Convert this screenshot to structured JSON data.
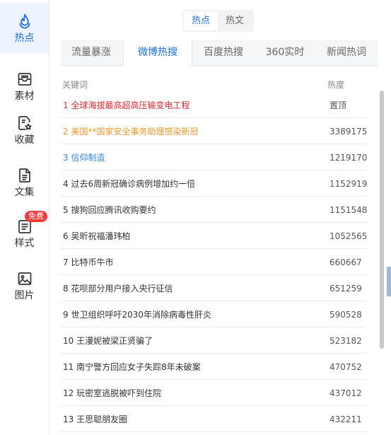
{
  "sidebar": {
    "items": [
      {
        "label": "热点",
        "icon": "flame-icon",
        "active": true
      },
      {
        "label": "素材",
        "icon": "inbox-icon"
      },
      {
        "label": "收藏",
        "icon": "bookmark-star-icon"
      },
      {
        "label": "文集",
        "icon": "document-icon"
      },
      {
        "label": "样式",
        "icon": "style-list-icon",
        "badge": "免费"
      },
      {
        "label": "图片",
        "icon": "image-icon"
      }
    ]
  },
  "segment": {
    "options": [
      "热点",
      "热文"
    ],
    "selected": "热点"
  },
  "tabs": [
    {
      "label": "流量暴涨"
    },
    {
      "label": "微博热搜",
      "active": true
    },
    {
      "label": "百度热搜"
    },
    {
      "label": "360实时"
    },
    {
      "label": "新闻热词"
    }
  ],
  "table": {
    "headers": {
      "keyword": "关键词",
      "heat": "热度"
    },
    "rows": [
      {
        "text": "1 全球海拔最高超高压输变电工程",
        "heat": "置顶",
        "color": "#d9282f"
      },
      {
        "text": "2 美国**国家安全事务助理感染新冠",
        "heat": "3389175",
        "color": "#f0962e"
      },
      {
        "text": "3 信仰制造",
        "heat": "1219170",
        "color": "#2f88d6"
      },
      {
        "text": "4 过去6周新冠确诊病例增加约一倍",
        "heat": "1152919"
      },
      {
        "text": "5 搜狗回应腾讯收购要约",
        "heat": "1151548"
      },
      {
        "text": "6 吴昕祝福潘玮柏",
        "heat": "1052565"
      },
      {
        "text": "7 比特币牛市",
        "heat": "660667"
      },
      {
        "text": "8 花呗部分用户接入央行征信",
        "heat": "651259"
      },
      {
        "text": "9 世卫组织呼吁2030年消除病毒性肝炎",
        "heat": "590528"
      },
      {
        "text": "10 王漫妮被梁正贤骗了",
        "heat": "523182"
      },
      {
        "text": "11 南宁警方回应女子失踪8年未破案",
        "heat": "470752"
      },
      {
        "text": "12 玩密室逃脱被吓到住院",
        "heat": "437012"
      },
      {
        "text": "13 王思聪朋友圈",
        "heat": "432211"
      }
    ]
  },
  "colors": {
    "accent": "#1e6fd9",
    "default_text": "#333333"
  }
}
